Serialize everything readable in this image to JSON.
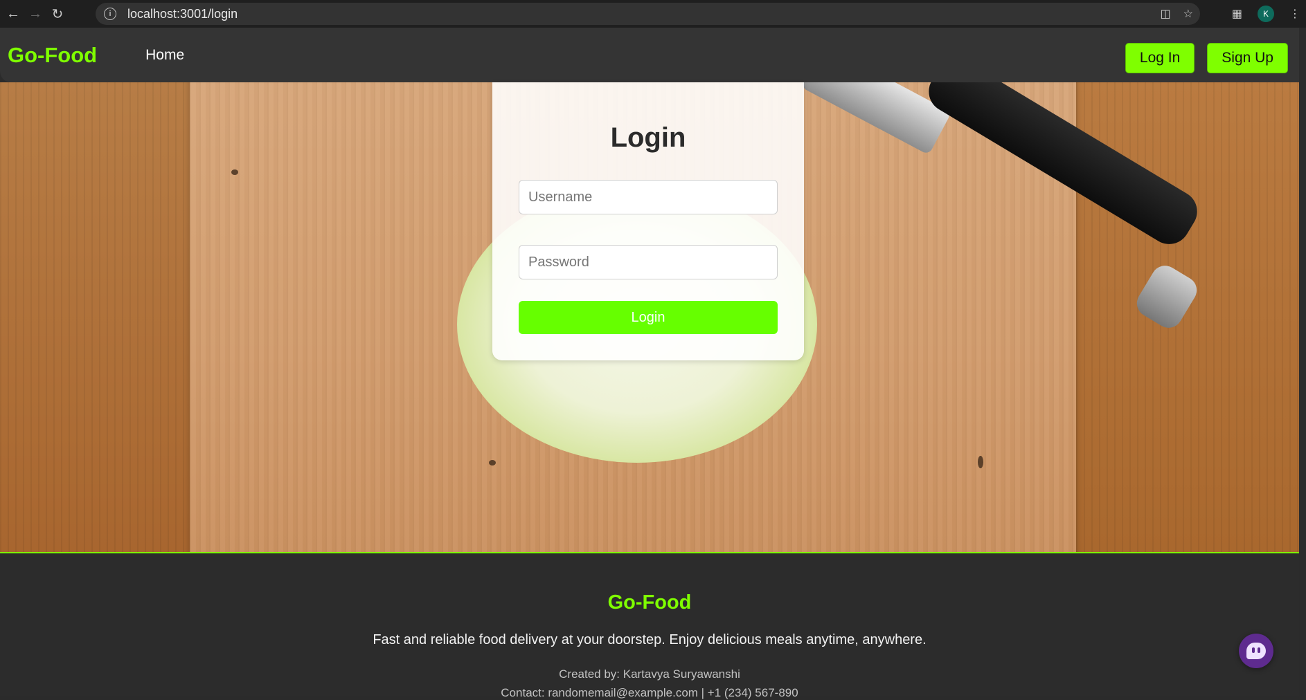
{
  "browser": {
    "url": "localhost:3001/login",
    "profile_initial": "K"
  },
  "navbar": {
    "brand": "Go-Food",
    "home_label": "Home",
    "login_label": "Log In",
    "signup_label": "Sign Up"
  },
  "login": {
    "title": "Login",
    "username_placeholder": "Username",
    "password_placeholder": "Password",
    "submit_label": "Login"
  },
  "footer": {
    "brand": "Go-Food",
    "tagline": "Fast and reliable food delivery at your doorstep. Enjoy delicious meals anytime, anywhere.",
    "created_by": "Created by: Kartavya Suryawanshi",
    "contact": "Contact: randomemail@example.com | +1 (234) 567-890"
  },
  "colors": {
    "accent": "#7fff00",
    "button_green": "#66ff00",
    "navbar_bg": "#343434",
    "footer_bg": "#2c2c2c"
  },
  "icons": [
    "back-arrow-icon",
    "forward-arrow-icon",
    "reload-icon",
    "site-info-icon",
    "install-app-icon",
    "bookmark-star-icon",
    "extensions-icon",
    "menu-dots-icon",
    "chat-bot-icon"
  ]
}
